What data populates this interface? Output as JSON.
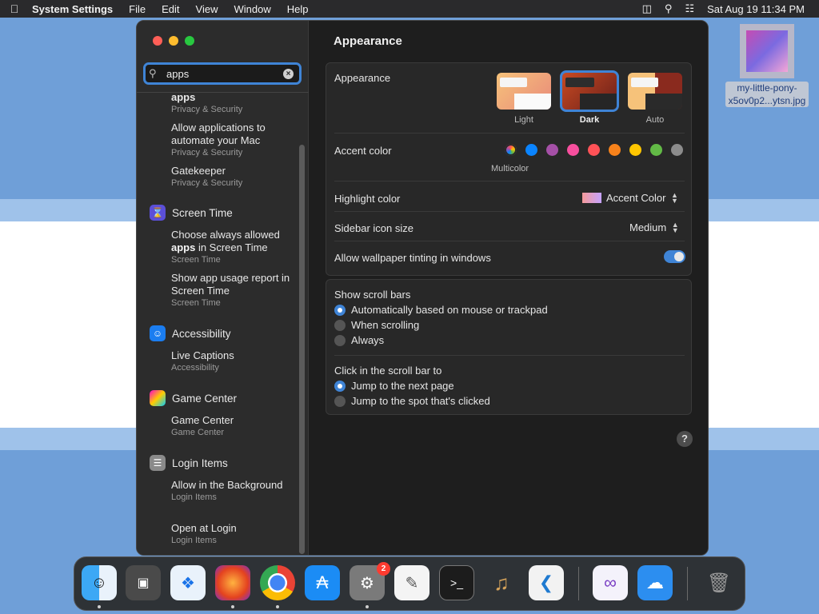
{
  "menubar": {
    "app_name": "System Settings",
    "menus": [
      "File",
      "Edit",
      "View",
      "Window",
      "Help"
    ],
    "clock": "Sat Aug 19  11:34 PM"
  },
  "sidebar": {
    "search_value": "apps",
    "results": [
      {
        "title": "apps",
        "subtitle": "Privacy & Security"
      },
      {
        "title": "Allow applications to automate your Mac",
        "subtitle": "Privacy & Security"
      },
      {
        "title": "Gatekeeper",
        "subtitle": "Privacy & Security"
      },
      {
        "category": "Screen Time"
      },
      {
        "title_pre": "Choose always allowed ",
        "title_bold": "apps",
        "title_post": " in Screen Time",
        "subtitle": "Screen Time"
      },
      {
        "title": "Show app usage report in Screen Time",
        "subtitle": "Screen Time"
      },
      {
        "category": "Accessibility"
      },
      {
        "title": "Live Captions",
        "subtitle": "Accessibility"
      },
      {
        "category": "Game Center"
      },
      {
        "title": "Game Center",
        "subtitle": "Game Center"
      },
      {
        "category": "Login Items"
      },
      {
        "title": "Allow in the Background",
        "subtitle": "Login Items"
      },
      {
        "title": "Open at Login",
        "subtitle": "Login Items"
      }
    ]
  },
  "content": {
    "title": "Appearance",
    "appearance_label": "Appearance",
    "appearance_options": [
      {
        "label": "Light",
        "selected": false
      },
      {
        "label": "Dark",
        "selected": true
      },
      {
        "label": "Auto",
        "selected": false
      }
    ],
    "accent_label": "Accent color",
    "accent_colors": [
      "#d8d8d8",
      "#0a84ff",
      "#a550a7",
      "#f74f9e",
      "#ff5257",
      "#f7821b",
      "#ffc600",
      "#62ba46",
      "#8c8c8c"
    ],
    "accent_selected_label": "Multicolor",
    "highlight_label": "Highlight color",
    "highlight_value": "Accent Color",
    "sidebar_icon_label": "Sidebar icon size",
    "sidebar_icon_value": "Medium",
    "tinting_label": "Allow wallpaper tinting in windows",
    "tinting_on": true,
    "scroll_bars_label": "Show scroll bars",
    "scroll_bars_options": [
      {
        "label": "Automatically based on mouse or trackpad",
        "selected": true
      },
      {
        "label": "When scrolling",
        "selected": false
      },
      {
        "label": "Always",
        "selected": false
      }
    ],
    "click_label": "Click in the scroll bar to",
    "click_options": [
      {
        "label": "Jump to the next page",
        "selected": true
      },
      {
        "label": "Jump to the spot that's clicked",
        "selected": false
      }
    ],
    "help": "?"
  },
  "desktop_file": {
    "name_line1": "my-little-pony-",
    "name_line2": "x5ov0p2...ytsn.jpg"
  },
  "dock": {
    "badge": "2"
  }
}
